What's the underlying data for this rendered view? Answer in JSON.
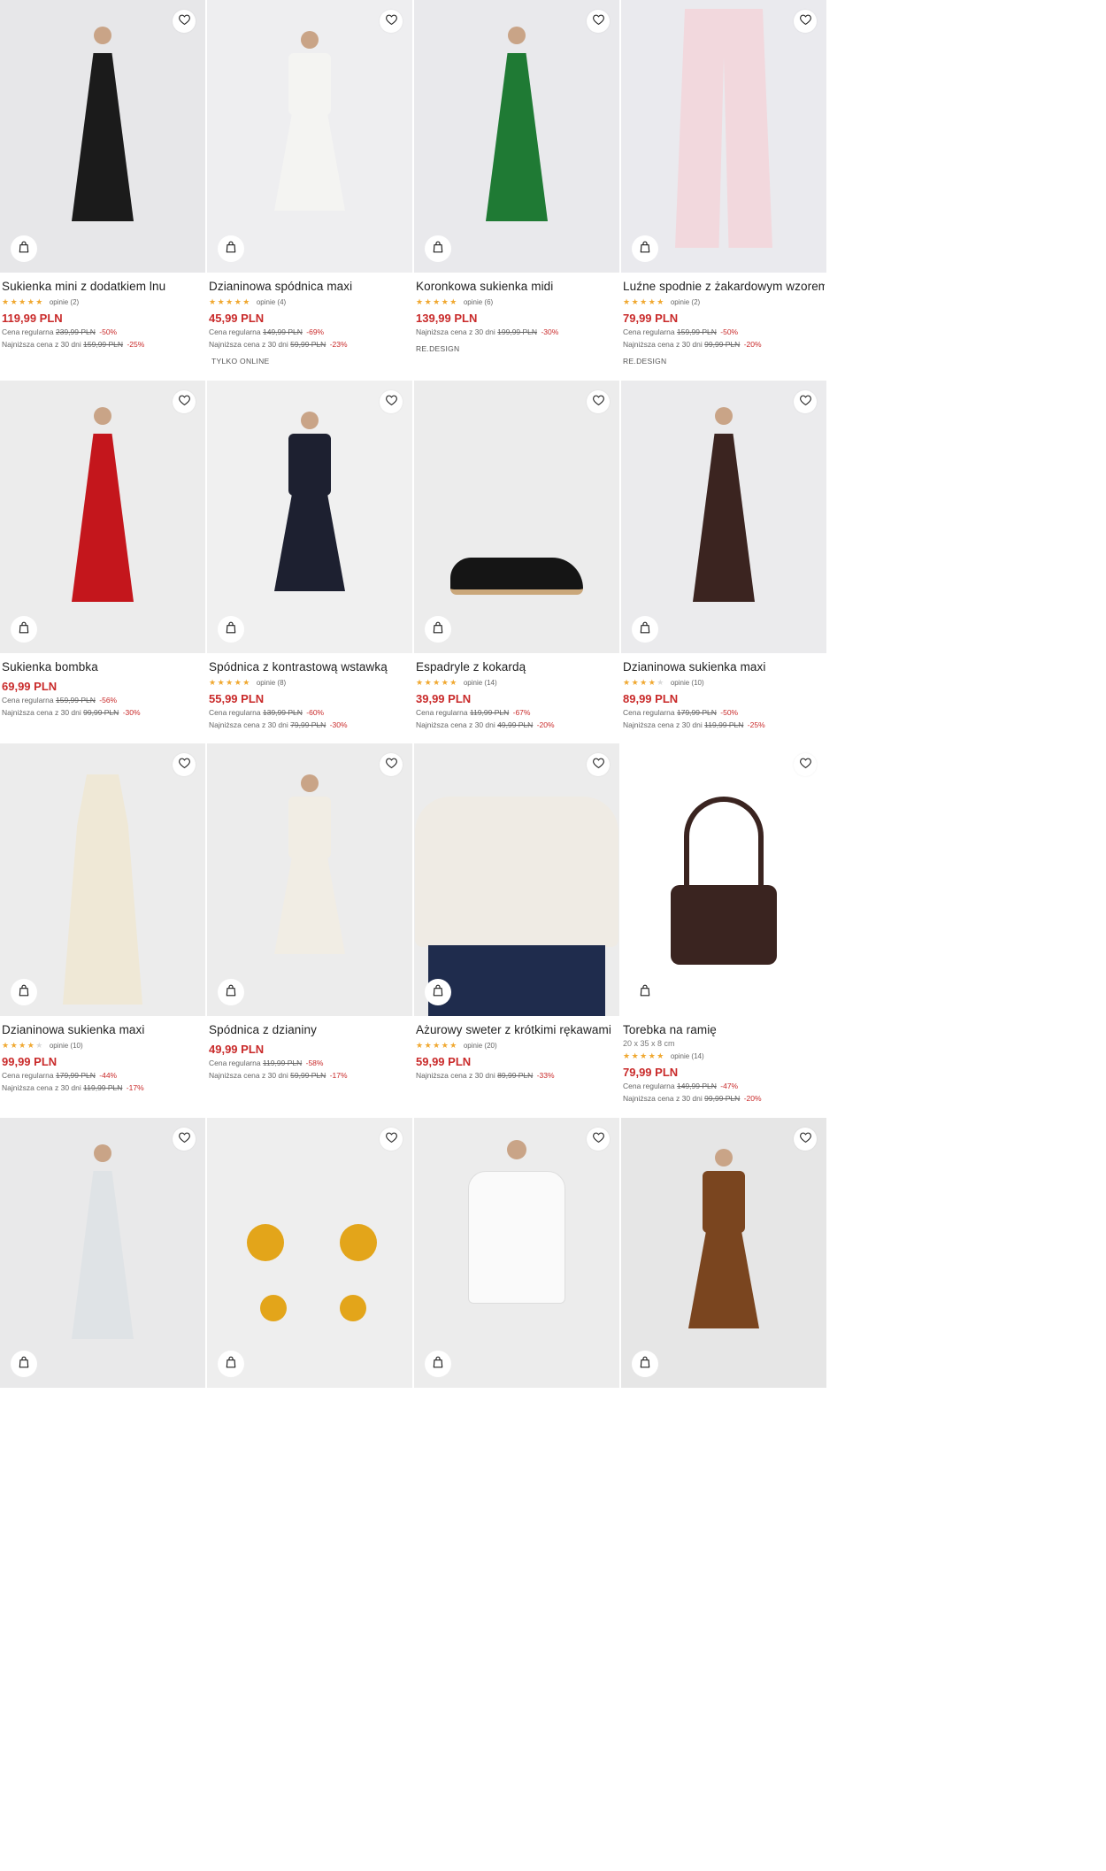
{
  "icons": {
    "favorite": "heart-outline-icon",
    "cart": "shopping-bag-icon",
    "star": "star-icon"
  },
  "colors": {
    "price": "#c92a2a",
    "star": "#f0a830",
    "image_bg": "#ececee"
  },
  "rows": [
    [
      {
        "title": "Sukienka mini z dodatkiem lnu",
        "rating": 4.5,
        "reviews": "opinie (2)",
        "price": "119,99 PLN",
        "regular_label": "Cena regularna",
        "regular_old": "239,99 PLN",
        "regular_pct": "-50%",
        "lowest_label": "Najniższa cena z 30 dni",
        "lowest_old": "159,99 PLN",
        "lowest_pct": "-25%",
        "tag": ""
      },
      {
        "title": "Dzianinowa spódnica maxi",
        "rating": 5,
        "reviews": "opinie (4)",
        "price": "45,99 PLN",
        "regular_label": "Cena regularna",
        "regular_old": "149,99 PLN",
        "regular_pct": "-69%",
        "lowest_label": "Najniższa cena z 30 dni",
        "lowest_old": "59,99 PLN",
        "lowest_pct": "-23%",
        "tag": "TYLKO ONLINE"
      },
      {
        "title": "Koronkowa sukienka midi",
        "rating": 4.5,
        "reviews": "opinie (6)",
        "price": "139,99 PLN",
        "lowest_label": "Najniższa cena z 30 dni",
        "lowest_old": "199,99 PLN",
        "lowest_pct": "-30%",
        "tag": "RE.DESIGN"
      },
      {
        "title": "Luźne spodnie z żakardowym wzorem",
        "rating": 5,
        "reviews": "opinie (2)",
        "price": "79,99 PLN",
        "regular_label": "Cena regularna",
        "regular_old": "159,99 PLN",
        "regular_pct": "-50%",
        "lowest_label": "Najniższa cena z 30 dni",
        "lowest_old": "99,99 PLN",
        "lowest_pct": "-20%",
        "tag": "RE.DESIGN"
      }
    ],
    [
      {
        "title": "Sukienka bombka",
        "price": "69,99 PLN",
        "regular_label": "Cena regularna",
        "regular_old": "159,99 PLN",
        "regular_pct": "-56%",
        "lowest_label": "Najniższa cena z 30 dni",
        "lowest_old": "99,99 PLN",
        "lowest_pct": "-30%"
      },
      {
        "title": "Spódnica z kontrastową wstawką",
        "rating": 5,
        "reviews": "opinie (8)",
        "price": "55,99 PLN",
        "regular_label": "Cena regularna",
        "regular_old": "139,99 PLN",
        "regular_pct": "-60%",
        "lowest_label": "Najniższa cena z 30 dni",
        "lowest_old": "79,99 PLN",
        "lowest_pct": "-30%"
      },
      {
        "title": "Espadryle z kokardą",
        "rating": 4.5,
        "reviews": "opinie (14)",
        "price": "39,99 PLN",
        "regular_label": "Cena regularna",
        "regular_old": "119,99 PLN",
        "regular_pct": "-67%",
        "lowest_label": "Najniższa cena z 30 dni",
        "lowest_old": "49,99 PLN",
        "lowest_pct": "-20%"
      },
      {
        "title": "Dzianinowa sukienka maxi",
        "rating": 4,
        "reviews": "opinie (10)",
        "price": "89,99 PLN",
        "regular_label": "Cena regularna",
        "regular_old": "179,99 PLN",
        "regular_pct": "-50%",
        "lowest_label": "Najniższa cena z 30 dni",
        "lowest_old": "119,99 PLN",
        "lowest_pct": "-25%"
      }
    ],
    [
      {
        "title": "Dzianinowa sukienka maxi",
        "rating": 4,
        "reviews": "opinie (10)",
        "price": "99,99 PLN",
        "regular_label": "Cena regularna",
        "regular_old": "179,99 PLN",
        "regular_pct": "-44%",
        "lowest_label": "Najniższa cena z 30 dni",
        "lowest_old": "119,99 PLN",
        "lowest_pct": "-17%"
      },
      {
        "title": "Spódnica z dzianiny",
        "price": "49,99 PLN",
        "regular_label": "Cena regularna",
        "regular_old": "119,99 PLN",
        "regular_pct": "-58%",
        "lowest_label": "Najniższa cena z 30 dni",
        "lowest_old": "59,99 PLN",
        "lowest_pct": "-17%"
      },
      {
        "title": "Ażurowy sweter z krótkimi rękawami",
        "rating": 4.5,
        "reviews": "opinie (20)",
        "price": "59,99 PLN",
        "lowest_label": "Najniższa cena z 30 dni",
        "lowest_old": "89,99 PLN",
        "lowest_pct": "-33%"
      },
      {
        "title": "Torebka na ramię",
        "dims": "20 x 35 x 8 cm",
        "rating": 5,
        "reviews": "opinie (14)",
        "price": "79,99 PLN",
        "regular_label": "Cena regularna",
        "regular_old": "149,99 PLN",
        "regular_pct": "-47%",
        "lowest_label": "Najniższa cena z 30 dni",
        "lowest_old": "99,99 PLN",
        "lowest_pct": "-20%"
      }
    ],
    [
      {},
      {},
      {},
      {}
    ]
  ]
}
